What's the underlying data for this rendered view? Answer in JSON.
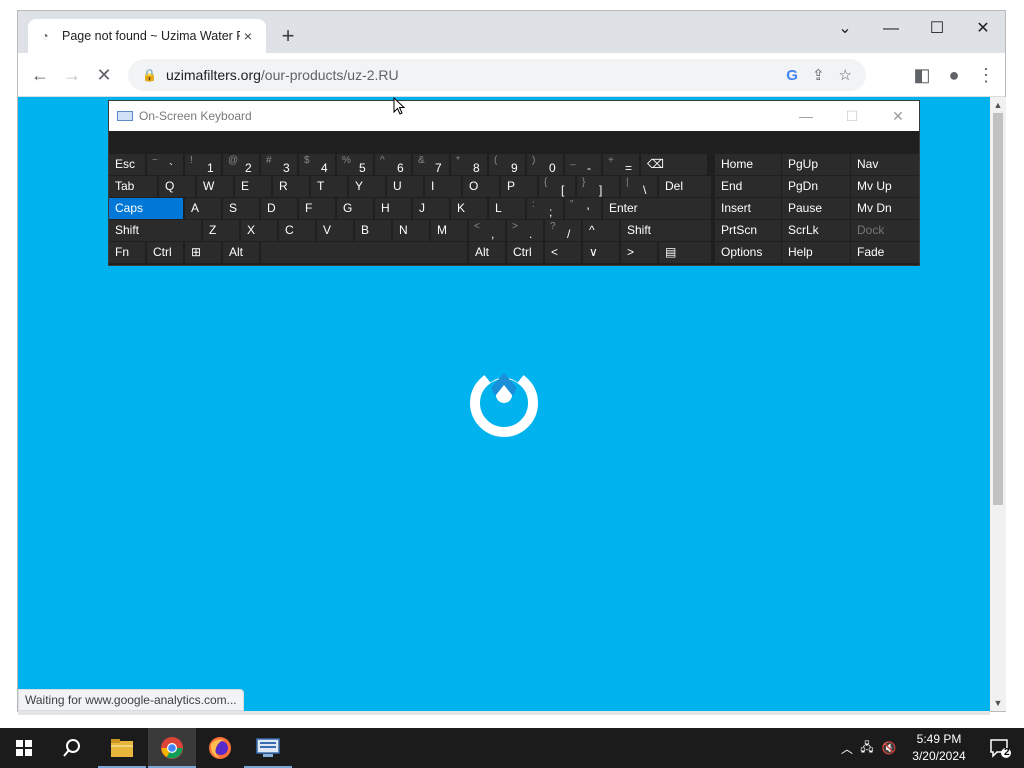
{
  "browser": {
    "tab_title": "Page not found ~ Uzima Water F",
    "tab_close": "×",
    "new_tab": "+",
    "url_host": "uzimafilters.org",
    "url_path": "/our-products/uz-2.RU",
    "status_text": "Waiting for www.google-analytics.com..."
  },
  "osk": {
    "title": "On-Screen Keyboard",
    "rows": [
      [
        {
          "l": "Esc"
        },
        {
          "s": "~",
          "m": "`"
        },
        {
          "s": "!",
          "m": "1"
        },
        {
          "s": "@",
          "m": "2"
        },
        {
          "s": "#",
          "m": "3"
        },
        {
          "s": "$",
          "m": "4"
        },
        {
          "s": "%",
          "m": "5"
        },
        {
          "s": "^",
          "m": "6"
        },
        {
          "s": "&",
          "m": "7"
        },
        {
          "s": "*",
          "m": "8"
        },
        {
          "s": "(",
          "m": "9"
        },
        {
          "s": ")",
          "m": "0"
        },
        {
          "s": "_",
          "m": "-"
        },
        {
          "s": "+",
          "m": "="
        },
        {
          "l": "⌫"
        }
      ],
      [
        {
          "l": "Tab"
        },
        {
          "l": "Q"
        },
        {
          "l": "W"
        },
        {
          "l": "E"
        },
        {
          "l": "R"
        },
        {
          "l": "T"
        },
        {
          "l": "Y"
        },
        {
          "l": "U"
        },
        {
          "l": "I"
        },
        {
          "l": "O"
        },
        {
          "l": "P"
        },
        {
          "s": "{",
          "m": "["
        },
        {
          "s": "}",
          "m": "]"
        },
        {
          "s": "|",
          "m": "\\"
        },
        {
          "l": "Del"
        }
      ],
      [
        {
          "l": "Caps"
        },
        {
          "l": "A"
        },
        {
          "l": "S"
        },
        {
          "l": "D"
        },
        {
          "l": "F"
        },
        {
          "l": "G"
        },
        {
          "l": "H"
        },
        {
          "l": "J"
        },
        {
          "l": "K"
        },
        {
          "l": "L"
        },
        {
          "s": ":",
          "m": ";"
        },
        {
          "s": "\"",
          "m": "'"
        },
        {
          "l": "Enter"
        }
      ],
      [
        {
          "l": "Shift"
        },
        {
          "l": "Z"
        },
        {
          "l": "X"
        },
        {
          "l": "C"
        },
        {
          "l": "V"
        },
        {
          "l": "B"
        },
        {
          "l": "N"
        },
        {
          "l": "M"
        },
        {
          "s": "<",
          "m": ","
        },
        {
          "s": ">",
          "m": "."
        },
        {
          "s": "?",
          "m": "/"
        },
        {
          "l": "^"
        },
        {
          "l": "Shift"
        }
      ],
      [
        {
          "l": "Fn"
        },
        {
          "l": "Ctrl"
        },
        {
          "l": "⊞"
        },
        {
          "l": "Alt"
        },
        {
          "l": ""
        },
        {
          "l": "Alt"
        },
        {
          "l": "Ctrl"
        },
        {
          "l": "<"
        },
        {
          "l": "∨"
        },
        {
          "l": ">"
        },
        {
          "l": "▤"
        }
      ]
    ],
    "nav_rows": [
      [
        "Home",
        "PgUp",
        "Nav"
      ],
      [
        "End",
        "PgDn",
        "Mv Up"
      ],
      [
        "Insert",
        "Pause",
        "Mv Dn"
      ],
      [
        "PrtScn",
        "ScrLk",
        "Dock"
      ],
      [
        "Options",
        "Help",
        "Fade"
      ]
    ]
  },
  "taskbar": {
    "time": "5:49 PM",
    "date": "3/20/2024",
    "notification_count": "2"
  },
  "colors": {
    "page_bg": "#00b2ee",
    "caps_active": "#0078d7"
  }
}
